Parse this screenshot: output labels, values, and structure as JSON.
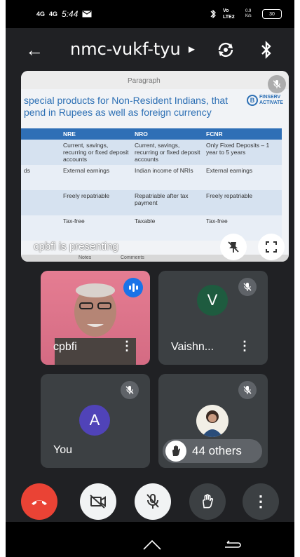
{
  "status": {
    "signal_1": "4G",
    "signal_2": "4G",
    "time": "5:44",
    "lte": "Vo LTE2",
    "speed": "0.9 K/s",
    "battery": "30"
  },
  "header": {
    "meeting_code": "nmc-vukf-tyu"
  },
  "slide": {
    "toolbar_label": "Paragraph",
    "headline_line1": "special products for Non-Resident Indians, that",
    "headline_line2": "pend in Rupees as well as foreign currency",
    "logo_line1": "FINSERV",
    "logo_line2": "ACTIVATE",
    "columns": [
      "",
      "NRE",
      "NRO",
      "FCNR"
    ],
    "rows": [
      [
        "",
        "Current, savings, recurring or fixed deposit accounts",
        "Current, savings, recurring or fixed deposit accounts",
        "Only Fixed Deposits – 1 year to 5 years"
      ],
      [
        "ds",
        "External earnings",
        "Indian income of NRIs",
        "External earnings"
      ],
      [
        "",
        "Freely repatriable",
        "Repatriable after tax payment",
        "Freely repatriable"
      ],
      [
        "",
        "Tax-free",
        "Taxable",
        "Tax-free"
      ]
    ],
    "bottom_labels": [
      "Notes",
      "Comments"
    ],
    "presenting_text": "cpbfi is presenting"
  },
  "participants": [
    {
      "name": "cpbfi"
    },
    {
      "name": "Vaishn...",
      "initial": "V",
      "color": "#1e5b3f"
    },
    {
      "name": "You",
      "initial": "A",
      "color": "#5043b8"
    }
  ],
  "others": {
    "label": "44 others"
  },
  "colors": {
    "end_call": "#ea4335",
    "speaking": "#1a73e8"
  }
}
